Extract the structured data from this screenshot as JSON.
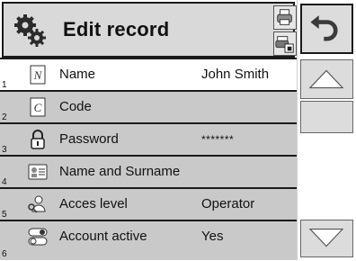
{
  "header": {
    "title": "Edit record"
  },
  "rows": [
    {
      "num": "1",
      "label": "Name",
      "value": "John Smith",
      "icon": "name-icon",
      "selected": true
    },
    {
      "num": "2",
      "label": "Code",
      "value": "",
      "icon": "code-icon"
    },
    {
      "num": "3",
      "label": "Password",
      "value": "*******",
      "icon": "lock-icon"
    },
    {
      "num": "4",
      "label": "Name and Surname",
      "value": "",
      "icon": "id-card-icon"
    },
    {
      "num": "5",
      "label": "Acces level",
      "value": "Operator",
      "icon": "user-key-icon"
    },
    {
      "num": "6",
      "label": "Account active",
      "value": "Yes",
      "icon": "toggle-icon"
    }
  ],
  "colors": {
    "header_bg": "#d9d9d9",
    "row_bg": "#c9c9c9",
    "selected_bg": "#ffffff",
    "border": "#1a1a1a"
  },
  "icons": [
    "gears-icon",
    "printer-icon",
    "print-preview-icon",
    "undo-icon",
    "arrow-up-icon",
    "arrow-down-icon"
  ]
}
